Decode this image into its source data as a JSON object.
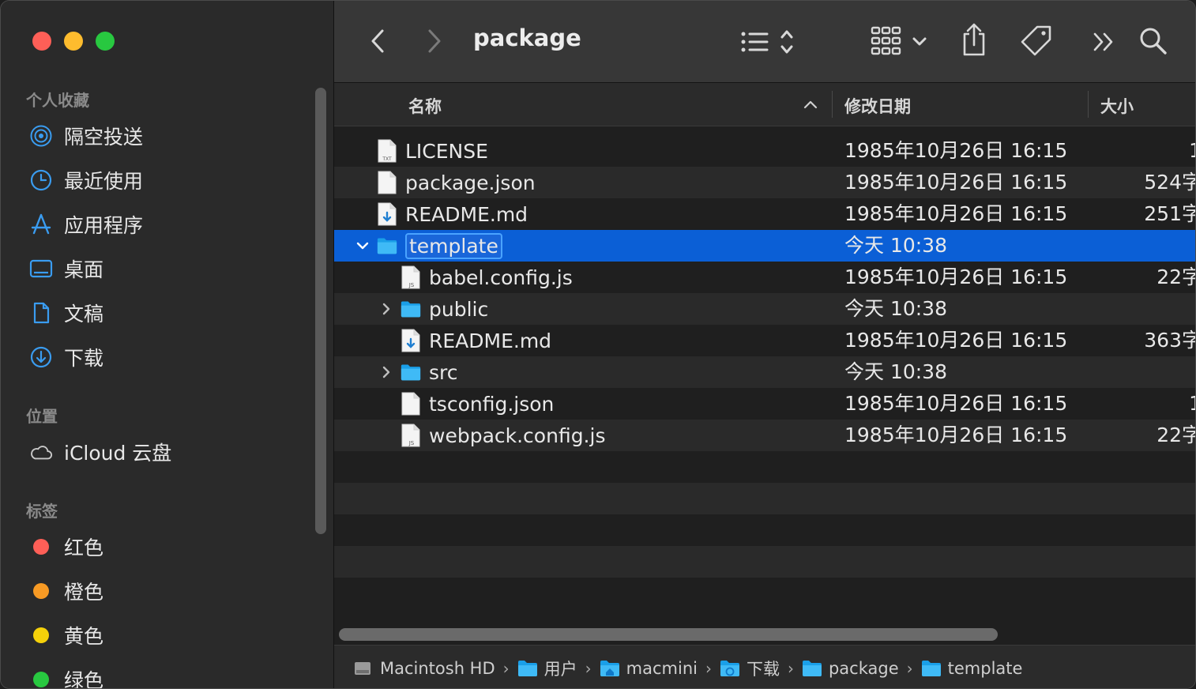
{
  "window": {
    "title": "package"
  },
  "sidebar": {
    "sections": [
      {
        "title": "个人收藏",
        "items": [
          {
            "label": "隔空投送",
            "icon": "airdrop-icon"
          },
          {
            "label": "最近使用",
            "icon": "clock-icon"
          },
          {
            "label": "应用程序",
            "icon": "applications-icon"
          },
          {
            "label": "桌面",
            "icon": "desktop-icon"
          },
          {
            "label": "文稿",
            "icon": "document-icon"
          },
          {
            "label": "下载",
            "icon": "download-icon"
          }
        ]
      },
      {
        "title": "位置",
        "items": [
          {
            "label": "iCloud 云盘",
            "icon": "cloud-icon"
          }
        ]
      },
      {
        "title": "标签",
        "items": [
          {
            "label": "红色",
            "color": "#fe5f57"
          },
          {
            "label": "橙色",
            "color": "#f79a24"
          },
          {
            "label": "黄色",
            "color": "#f5d10a"
          },
          {
            "label": "绿色",
            "color": "#28c840"
          }
        ]
      }
    ]
  },
  "columns": {
    "name": "名称",
    "date": "修改日期",
    "size": "大小"
  },
  "files": [
    {
      "name": "LICENSE",
      "date": "1985年10月26日 16:15",
      "size": "1",
      "type": "txt",
      "level": 0
    },
    {
      "name": "package.json",
      "date": "1985年10月26日 16:15",
      "size": "524字",
      "type": "file",
      "level": 0
    },
    {
      "name": "README.md",
      "date": "1985年10月26日 16:15",
      "size": "251字",
      "type": "md",
      "level": 0
    },
    {
      "name": "template",
      "date": "今天 10:38",
      "size": "",
      "type": "folder",
      "level": 0,
      "expanded": true,
      "selected": true
    },
    {
      "name": "babel.config.js",
      "date": "1985年10月26日 16:15",
      "size": "22字",
      "type": "js",
      "level": 1
    },
    {
      "name": "public",
      "date": "今天 10:38",
      "size": "",
      "type": "folder",
      "level": 1,
      "expanded": false
    },
    {
      "name": "README.md",
      "date": "1985年10月26日 16:15",
      "size": "363字",
      "type": "md",
      "level": 1
    },
    {
      "name": "src",
      "date": "今天 10:38",
      "size": "",
      "type": "folder",
      "level": 1,
      "expanded": false
    },
    {
      "name": "tsconfig.json",
      "date": "1985年10月26日 16:15",
      "size": "1",
      "type": "file",
      "level": 1
    },
    {
      "name": "webpack.config.js",
      "date": "1985年10月26日 16:15",
      "size": "22字",
      "type": "js",
      "level": 1
    }
  ],
  "path": [
    {
      "label": "Macintosh HD",
      "icon": "disk-icon"
    },
    {
      "label": "用户",
      "icon": "folder-icon"
    },
    {
      "label": "macmini",
      "icon": "home-folder-icon"
    },
    {
      "label": "下载",
      "icon": "download-folder-icon"
    },
    {
      "label": "package",
      "icon": "folder-icon"
    },
    {
      "label": "template",
      "icon": "folder-icon"
    }
  ],
  "colors": {
    "accent": "#0b5fd6",
    "folder": "#1fa8f0"
  }
}
